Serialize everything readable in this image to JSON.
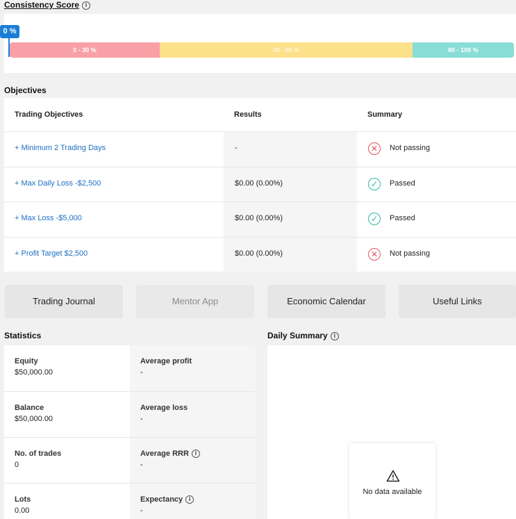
{
  "consistency": {
    "title": "Consistency Score",
    "score_label": "0 %",
    "score_value": 0,
    "bands": [
      "0 - 30 %",
      "30 - 80 %",
      "80 - 100 %"
    ],
    "colors": {
      "low": "#f9a0a6",
      "mid": "#fde08a",
      "high": "#88ddd6",
      "marker": "#1a7ed8"
    }
  },
  "objectives": {
    "title": "Objectives",
    "headers": [
      "Trading Objectives",
      "Results",
      "Summary"
    ],
    "rows": [
      {
        "objective": "+ Minimum 2 Trading Days",
        "result": "-",
        "status": "Not passing",
        "status_icon": "x-circle-icon"
      },
      {
        "objective": "+ Max Daily Loss -$2,500",
        "result": "$0.00 (0.00%)",
        "status": "Passed",
        "status_icon": "check-circle-icon"
      },
      {
        "objective": "+ Max Loss -$5,000",
        "result": "$0.00 (0.00%)",
        "status": "Passed",
        "status_icon": "check-circle-icon"
      },
      {
        "objective": "+ Profit Target $2,500",
        "result": "$0.00 (0.00%)",
        "status": "Not passing",
        "status_icon": "x-circle-icon"
      }
    ]
  },
  "apps": {
    "buttons": [
      "Trading Journal",
      "Mentor App",
      "Economic Calendar",
      "Useful Links"
    ]
  },
  "statistics": {
    "title": "Statistics",
    "left": [
      {
        "label": "Equity",
        "value": "$50,000.00"
      },
      {
        "label": "Balance",
        "value": "$50,000.00"
      },
      {
        "label": "No. of trades",
        "value": "0"
      },
      {
        "label": "Lots",
        "value": "0.00"
      }
    ],
    "right": [
      {
        "label": "Average profit",
        "value": "-"
      },
      {
        "label": "Average loss",
        "value": "-"
      },
      {
        "label": "Average RRR",
        "value": "-"
      },
      {
        "label": "Expectancy",
        "value": "-"
      }
    ]
  },
  "daily_summary": {
    "title": "Daily Summary",
    "empty_text": "No data available",
    "empty_icon": "warning-icon"
  }
}
